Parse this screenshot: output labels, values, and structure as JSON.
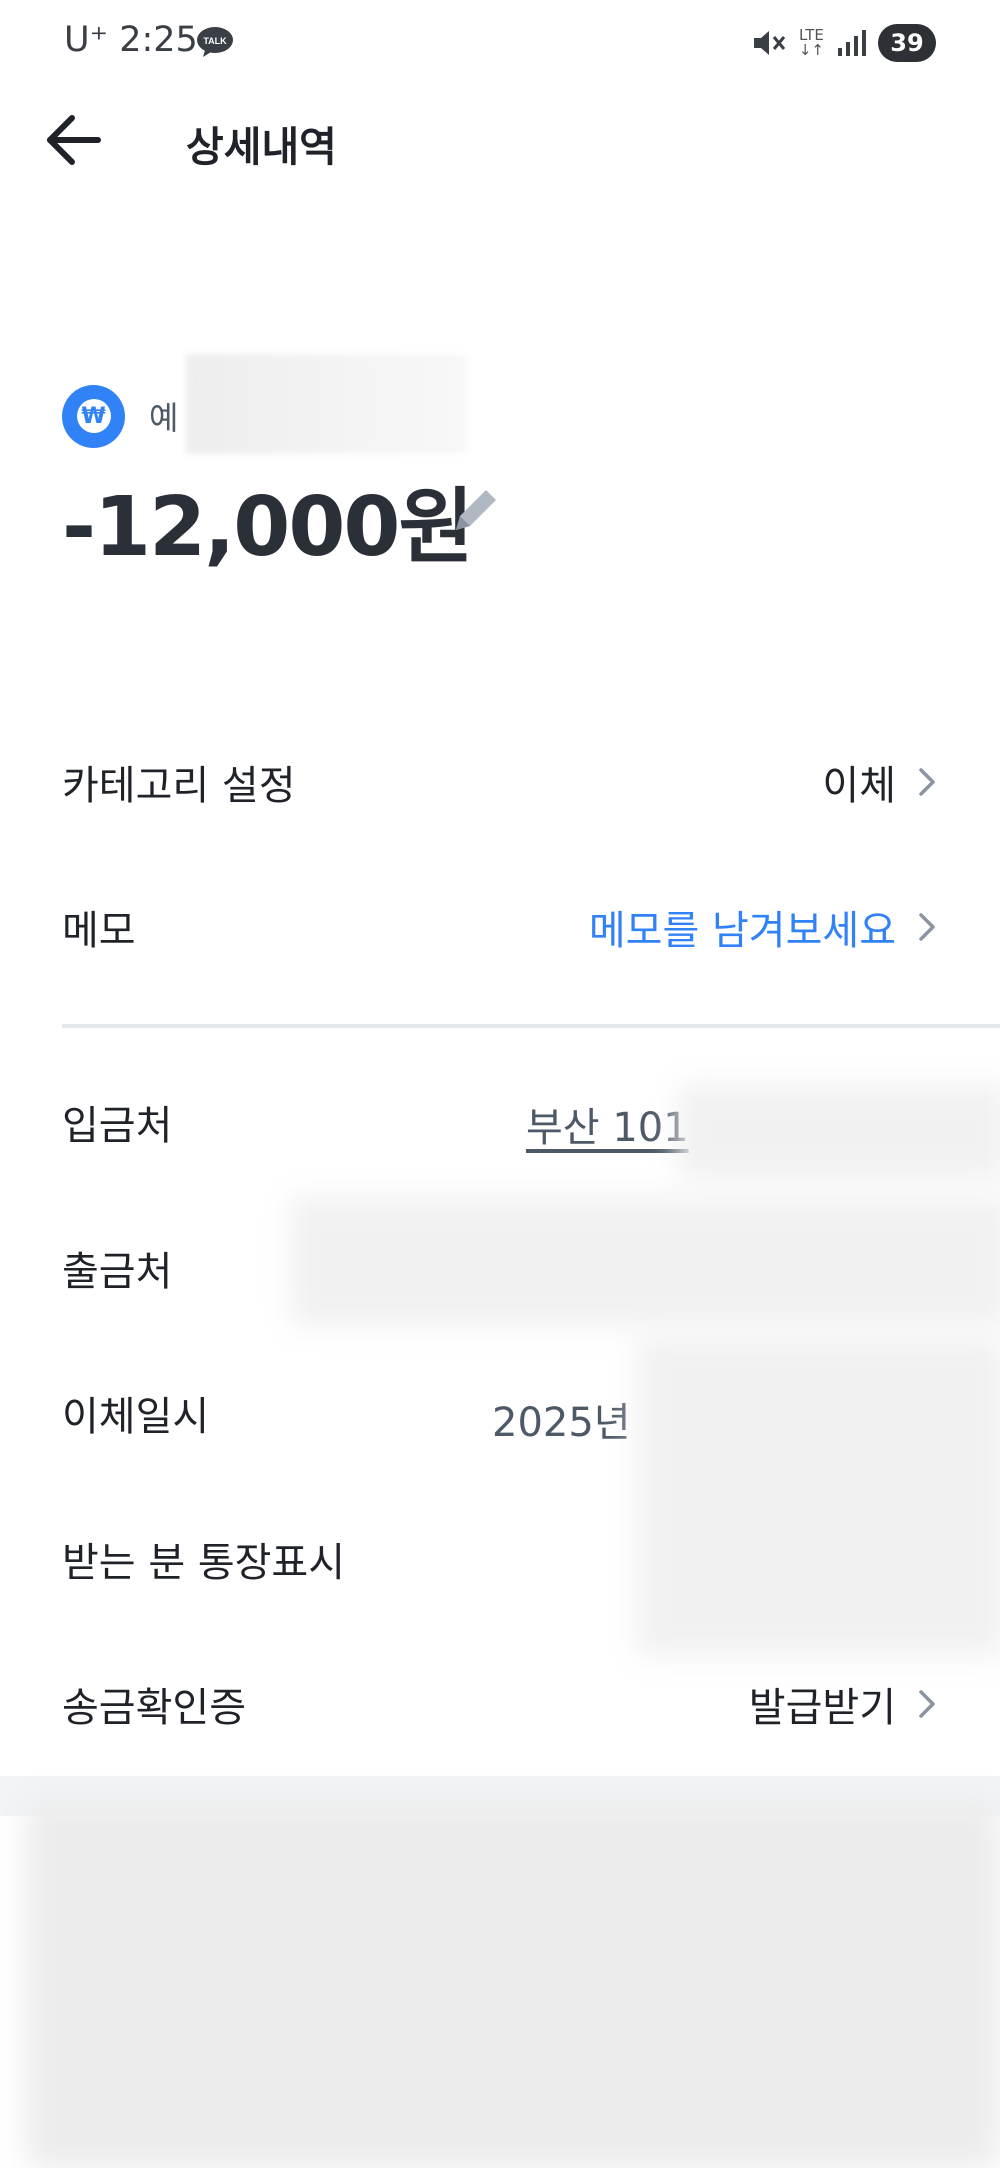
{
  "status_bar": {
    "carrier_time": "U⁺ 2:25",
    "talk_badge": "TALK",
    "lte_top": "LTE",
    "lte_bottom": "↓↑",
    "battery": "39"
  },
  "header": {
    "title": "상세내역"
  },
  "transaction": {
    "account_prefix": "예",
    "amount": "-12,000원"
  },
  "rows": {
    "category": {
      "label": "카테고리 설정",
      "value": "이체"
    },
    "memo": {
      "label": "메모",
      "value": "메모를 남겨보세요"
    },
    "deposit_to": {
      "label": "입금처",
      "value": "부산 101"
    },
    "withdraw_from": {
      "label": "출금처"
    },
    "transfer_datetime": {
      "label": "이체일시",
      "value": "2025년"
    },
    "recipient_display": {
      "label": "받는 분 통장표시"
    },
    "transfer_certificate": {
      "label": "송금확인증",
      "value": "발급받기"
    }
  },
  "colors": {
    "accent": "#3182f6",
    "text": "#1f2329",
    "divider": "#e5e8eb"
  },
  "icons": [
    "talk-icon",
    "mute-icon",
    "signal-icon",
    "back-arrow-icon",
    "won-icon",
    "pencil-icon",
    "chevron-right-icon"
  ]
}
